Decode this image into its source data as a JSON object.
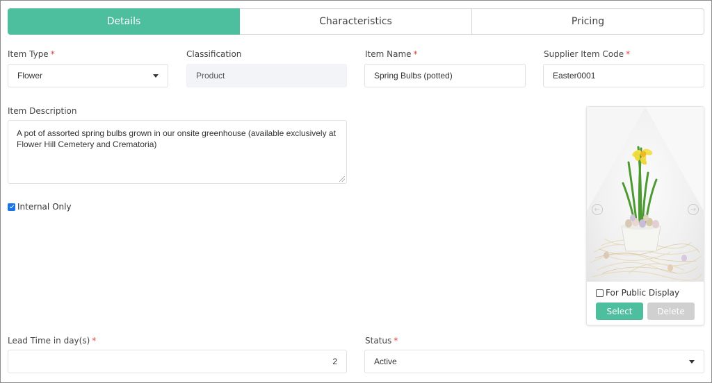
{
  "tabs": [
    {
      "label": "Details",
      "active": true
    },
    {
      "label": "Characteristics",
      "active": false
    },
    {
      "label": "Pricing",
      "active": false
    }
  ],
  "fields": {
    "item_type": {
      "label": "Item Type",
      "required": "*",
      "value": "Flower"
    },
    "classification": {
      "label": "Classification",
      "value": "Product"
    },
    "item_name": {
      "label": "Item Name",
      "required": "*",
      "value": "Spring Bulbs (potted)"
    },
    "supplier_code": {
      "label": "Supplier Item Code",
      "required": "*",
      "value": "Easter0001"
    },
    "description": {
      "label": "Item Description",
      "value": "A pot of assorted spring bulbs grown in our onsite greenhouse (available exclusively at Flower Hill Cemetery and Crematoria)"
    },
    "internal_only": {
      "label": "Internal Only",
      "checked": true
    },
    "lead_time": {
      "label": "Lead Time in day(s)",
      "required": "*",
      "value": "2"
    },
    "status": {
      "label": "Status",
      "required": "*",
      "value": "Active"
    }
  },
  "image_card": {
    "public_display_label": "For Public Display",
    "public_display_checked": false,
    "select_label": "Select",
    "delete_label": "Delete",
    "prev_icon": "chevron-left-circle-icon",
    "next_icon": "chevron-right-circle-icon"
  },
  "colors": {
    "accent": "#4dbf9f",
    "required": "#e0413a",
    "checkbox": "#1a73e8",
    "disabled_button": "#d0d0d0"
  }
}
